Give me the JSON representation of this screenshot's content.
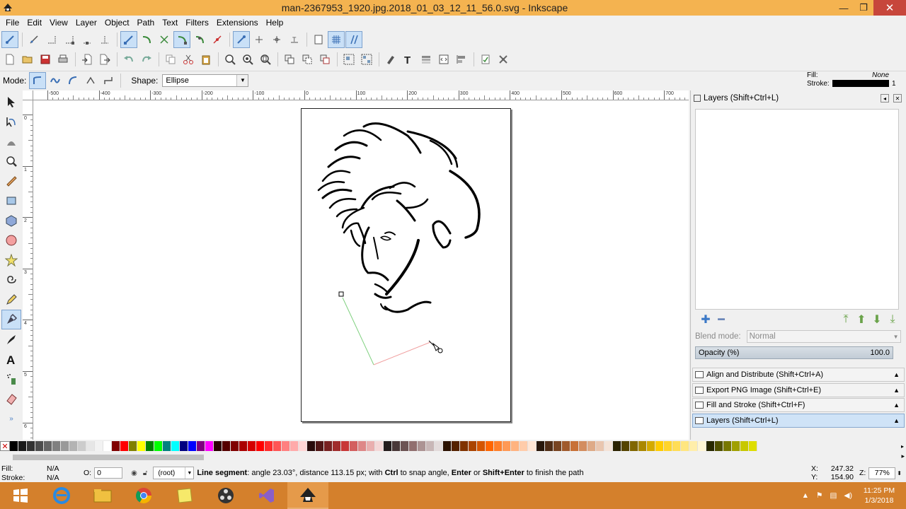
{
  "window": {
    "title": "man-2367953_1920.jpg.2018_01_03_12_11_56.0.svg - Inkscape",
    "min": "—",
    "max": "❐",
    "close": "✕"
  },
  "menu": [
    {
      "label": "File"
    },
    {
      "label": "Edit"
    },
    {
      "label": "View"
    },
    {
      "label": "Layer"
    },
    {
      "label": "Object"
    },
    {
      "label": "Path"
    },
    {
      "label": "Text"
    },
    {
      "label": "Filters"
    },
    {
      "label": "Extensions"
    },
    {
      "label": "Help"
    }
  ],
  "tool_controls": {
    "mode_label": "Mode:",
    "shape_label": "Shape:",
    "shape_value": "Ellipse"
  },
  "style_indicator": {
    "fill_label": "Fill:",
    "fill_value": "None",
    "stroke_label": "Stroke:",
    "stroke_width": "1"
  },
  "ruler": {
    "h_labels": [
      "-500",
      "-400",
      "-300",
      "-200",
      "-100",
      "0",
      "100",
      "200",
      "300",
      "400",
      "500",
      "600",
      "700"
    ],
    "v_labels": [
      "0",
      "1",
      "2",
      "3",
      "4",
      "5",
      "6"
    ]
  },
  "layers_panel": {
    "title": "Layers (Shift+Ctrl+L)",
    "blend_label": "Blend mode:",
    "blend_value": "Normal",
    "opacity_label": "Opacity (%)",
    "opacity_value": "100.0"
  },
  "dialogs": [
    {
      "label": "Align and Distribute (Shift+Ctrl+A)"
    },
    {
      "label": "Export PNG Image (Shift+Ctrl+E)"
    },
    {
      "label": "Fill and Stroke (Shift+Ctrl+F)"
    },
    {
      "label": "Layers (Shift+Ctrl+L)"
    }
  ],
  "palette": [
    "#000000",
    "#1a1a1a",
    "#333333",
    "#4d4d4d",
    "#666666",
    "#808080",
    "#999999",
    "#b3b3b3",
    "#cccccc",
    "#e6e6e6",
    "#f2f2f2",
    "#ffffff",
    "#800000",
    "#ff0000",
    "#808000",
    "#ffff00",
    "#008000",
    "#00ff00",
    "#008080",
    "#00ffff",
    "#000080",
    "#0000ff",
    "#800080",
    "#ff00ff",
    "#2b0000",
    "#550000",
    "#800000",
    "#aa0000",
    "#d40000",
    "#ff0000",
    "#ff2a2a",
    "#ff5555",
    "#ff8080",
    "#ffaaaa",
    "#ffd5d5",
    "#280b0b",
    "#501616",
    "#782121",
    "#a02c2c",
    "#c83737",
    "#d35f5f",
    "#de8787",
    "#e9afaf",
    "#f4d7d7",
    "#241c1c",
    "#483737",
    "#6c5353",
    "#916f6f",
    "#ac9393",
    "#c8b7b7",
    "#e3dbdb",
    "#2b1100",
    "#552200",
    "#803300",
    "#aa4400",
    "#d45500",
    "#ff6600",
    "#ff7f2a",
    "#ff9955",
    "#ffb380",
    "#ffccaa",
    "#ffe6d5",
    "#28170b",
    "#502d16",
    "#784421",
    "#a05a2c",
    "#c87137",
    "#d38d5f",
    "#deaa87",
    "#e9c6af",
    "#f4e3d7",
    "#2b2200",
    "#554400",
    "#806600",
    "#aa8800",
    "#d4aa00",
    "#ffcc00",
    "#ffd42a",
    "#ffdd55",
    "#ffe680",
    "#ffeeaa",
    "#fff6d5",
    "#282800",
    "#505000",
    "#787800",
    "#a0a000",
    "#c8c800",
    "#dede00"
  ],
  "status": {
    "fill_label": "Fill:",
    "fill_value": "N/A",
    "stroke_label": "Stroke:",
    "stroke_value": "N/A",
    "o_label": "O:",
    "o_value": "0",
    "layer_value": "(root)",
    "message_bold": "Line segment",
    "message_rest": ": angle 23.03°, distance 113.15 px; with ",
    "msg_ctrl": "Ctrl",
    "msg_mid": " to snap angle, ",
    "msg_enter": "Enter",
    "msg_or": " or ",
    "msg_shift_enter": "Shift+Enter",
    "msg_end": " to finish the path",
    "x_label": "X:",
    "x_value": "247.32",
    "y_label": "Y:",
    "y_value": "154.90",
    "zoom_label": "Z:",
    "zoom_value": "77%"
  },
  "taskbar": {
    "time": "11:25 PM",
    "date": "1/3/2018"
  }
}
